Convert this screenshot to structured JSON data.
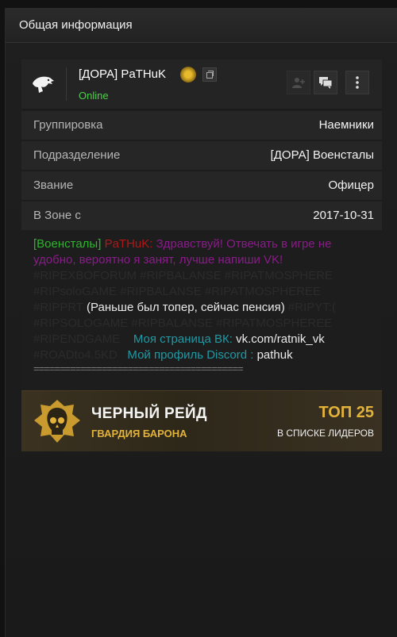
{
  "header": {
    "title": "Общая информация"
  },
  "profile": {
    "username": "[ДОРА] PaTHuK",
    "status": "Online",
    "icons": [
      "eagle-clan-icon",
      "rank-badge-icon",
      "copy-icon",
      "add-friend-icon",
      "chat-icon",
      "more-icon"
    ]
  },
  "info_rows": [
    {
      "label": "Группировка",
      "value": "Наемники"
    },
    {
      "label": "Подразделение",
      "value": "[ДОРА] Военсталы"
    },
    {
      "label": "Звание",
      "value": "Офицер"
    },
    {
      "label": "В Зоне с",
      "value": "2017-10-31"
    }
  ],
  "about": {
    "tag": "[Военсталы]",
    "name": "PaTHuK:",
    "greeting": "Здравствуй! Отвечать в игре не",
    "greeting2": "удобно, вероятно я занят, лучше напиши VK!",
    "hash1": "#RIPEXBOFORUM #RIPBALANSE #RIPATMOSPHERE",
    "hash2": "#RIPsoloGAME #RIPBALANSE #RIPATMOSPHEREE",
    "hash3a": "#RIPPRT",
    "note": "(Раньше был топер, сейчас пенсия)",
    "hash3b": "#RIPYT:(",
    "hash4": "#RIPSOLOGAME #RIPBALANSE #RIPATMOSPHEREE",
    "hash5": "#RIPENDGAME",
    "vk_label": "Моя страница ВК:",
    "vk_value": "vk.com/ratnik_vk",
    "hash6": "#ROADto4.5KD",
    "discord_label": "Мой профиль Discord :",
    "discord_value": "pathuk",
    "divider": "========================================"
  },
  "raid": {
    "title": "ЧЕРНЫЙ РЕЙД",
    "subtitle": "ГВАРДИЯ БАРОНА",
    "top": "ТОП 25",
    "top_sub": "В СПИСКЕ ЛИДЕРОВ"
  },
  "colors": {
    "online": "#4bd24b",
    "accent_gold": "#e2b23a",
    "clan_tag": "#2db52d",
    "name": "#b01818",
    "message": "#8a1b8a",
    "links": "#1f9aa5"
  }
}
